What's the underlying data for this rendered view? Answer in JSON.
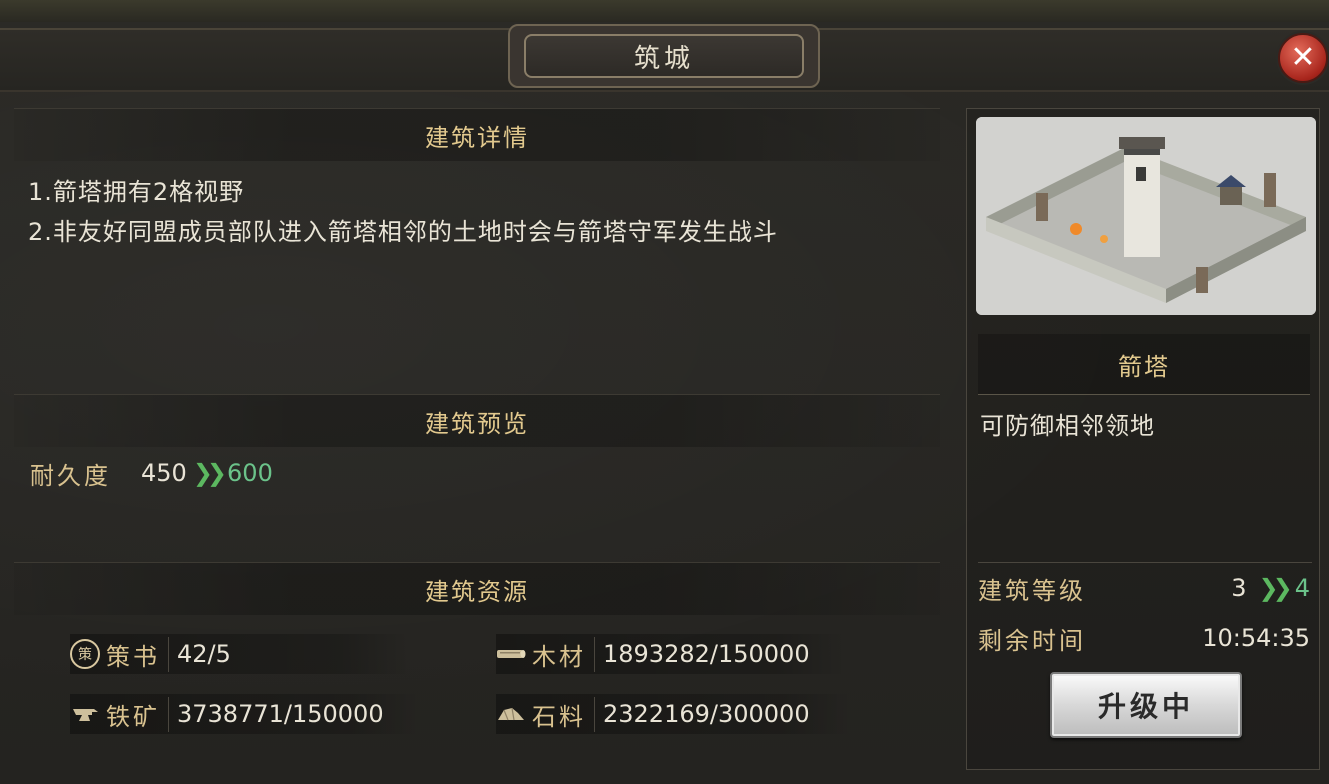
{
  "window": {
    "title": "筑城"
  },
  "detail": {
    "heading": "建筑详情",
    "lines": [
      "1.箭塔拥有2格视野",
      "2.非友好同盟成员部队进入箭塔相邻的土地时会与箭塔守军发生战斗"
    ]
  },
  "preview": {
    "heading": "建筑预览",
    "durability_label": "耐久度",
    "durability_current": "450",
    "durability_next": "600"
  },
  "resources": {
    "heading": "建筑资源",
    "items": [
      {
        "icon": "scroll-badge-icon",
        "badge": "策",
        "label": "策书",
        "value": "42/5"
      },
      {
        "icon": "wood-icon",
        "label": "木材",
        "value": "1893282/150000"
      },
      {
        "icon": "anvil-icon",
        "label": "铁矿",
        "value": "3738771/150000"
      },
      {
        "icon": "stone-icon",
        "label": "石料",
        "value": "2322169/300000"
      }
    ]
  },
  "building": {
    "name": "箭塔",
    "description": "可防御相邻领地",
    "level_label": "建筑等级",
    "level_current": "3",
    "level_next": "4",
    "time_label": "剩余时间",
    "time_value": "10:54:35",
    "button_label": "升级中"
  },
  "colors": {
    "accent_gold": "#e2c98e",
    "next_value_green": "#6bc38a",
    "arrow_green": "#5cb860",
    "close_red": "#a8251c"
  }
}
